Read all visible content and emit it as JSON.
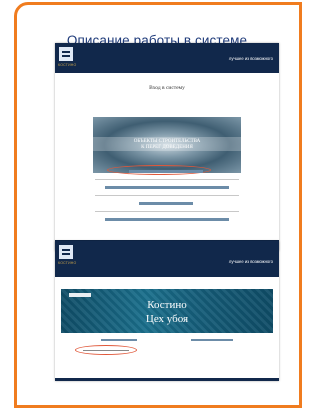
{
  "slide": {
    "title": "Описание работы в системе",
    "accent_color": "#f07c1f",
    "link_color": "#1f3b7a"
  },
  "screenshot_login": {
    "logo_text": "КОСТИНО",
    "slogan": "лучшее из возможного",
    "page_title": "Вход в систему",
    "banner_line1": "ОБЪЕКТЫ СТРОИТЕЛЬСТВА",
    "banner_line2": "К ПЕРЕГ ДОВЕДЕНИЯ",
    "footer_year": "2019",
    "footer_author": "Блохинов Е.А."
  },
  "screenshot_main": {
    "logo_text": "КОСТИНО",
    "slogan": "лучшее из возможного",
    "banner_line1": "Костино",
    "banner_line2": "Цех убоя"
  }
}
